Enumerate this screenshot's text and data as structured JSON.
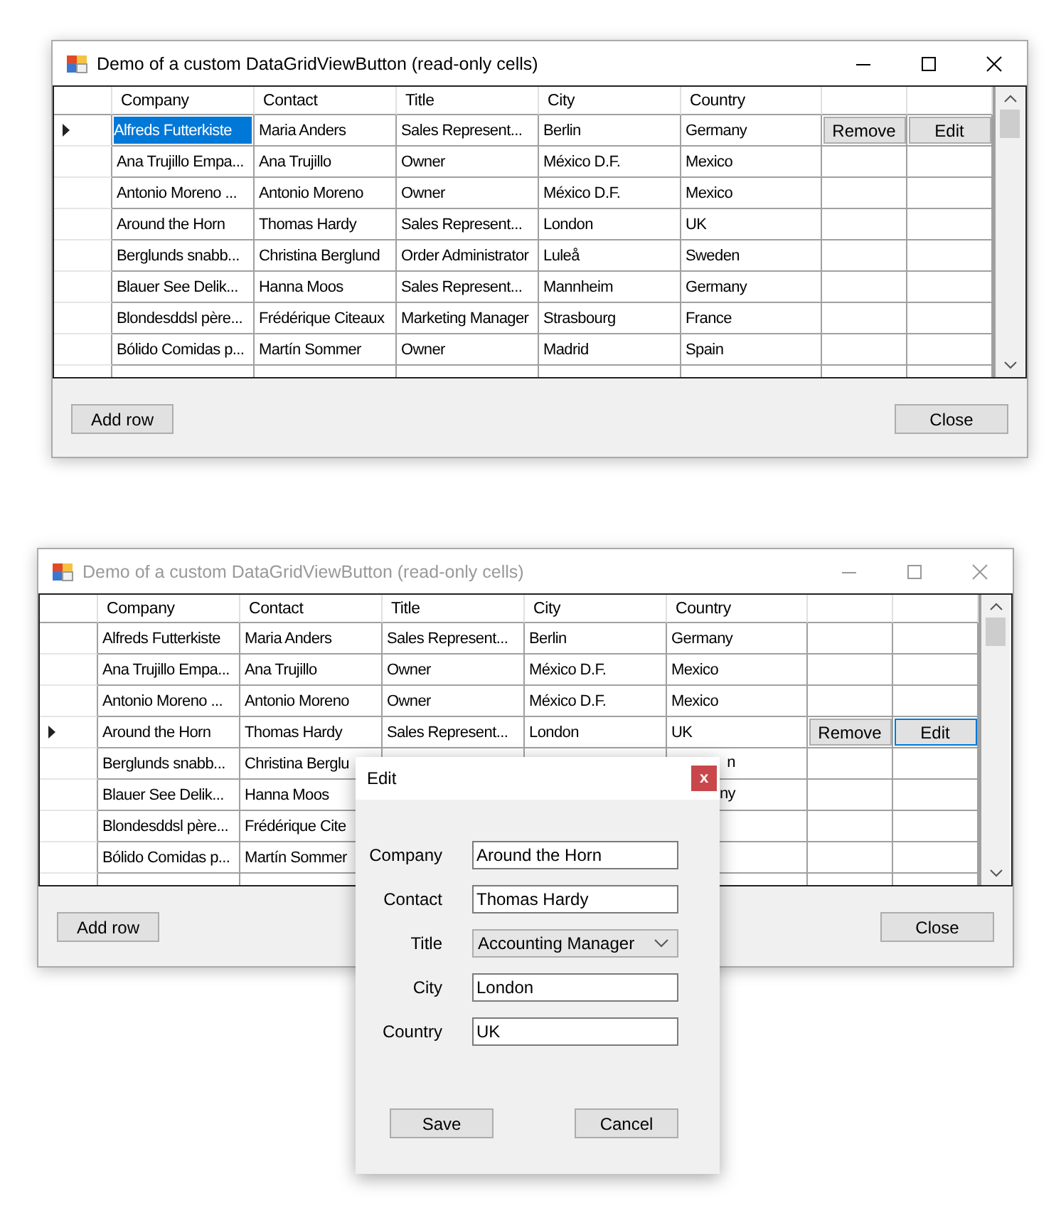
{
  "windows": [
    {
      "title": "Demo of a custom DataGridViewButton (read-only cells)",
      "active": true,
      "grid": {
        "columns": [
          "Company",
          "Contact",
          "Title",
          "City",
          "Country"
        ],
        "row_buttons": [
          {
            "label": "Remove",
            "focused": false
          },
          {
            "label": "Edit",
            "focused": false
          }
        ],
        "rows": [
          {
            "current": true,
            "company": "Alfreds Futterkiste",
            "contact": "Maria Anders",
            "title": "Sales Represent...",
            "city": "Berlin",
            "country": "Germany"
          },
          {
            "current": false,
            "company": "Ana Trujillo Empa...",
            "contact": "Ana Trujillo",
            "title": "Owner",
            "city": "México D.F.",
            "country": "Mexico"
          },
          {
            "current": false,
            "company": "Antonio Moreno ...",
            "contact": "Antonio Moreno",
            "title": "Owner",
            "city": "México D.F.",
            "country": "Mexico"
          },
          {
            "current": false,
            "company": "Around the Horn",
            "contact": "Thomas Hardy",
            "title": "Sales Represent...",
            "city": "London",
            "country": "UK"
          },
          {
            "current": false,
            "company": "Berglunds snabb...",
            "contact": "Christina Berglund",
            "title": "Order Administrator",
            "city": "Luleå",
            "country": "Sweden"
          },
          {
            "current": false,
            "company": "Blauer See Delik...",
            "contact": "Hanna Moos",
            "title": "Sales Represent...",
            "city": "Mannheim",
            "country": "Germany"
          },
          {
            "current": false,
            "company": "Blondesddsl père...",
            "contact": "Frédérique Citeaux",
            "title": "Marketing Manager",
            "city": "Strasbourg",
            "country": "France"
          },
          {
            "current": false,
            "company": "Bólido Comidas p...",
            "contact": "Martín Sommer",
            "title": "Owner",
            "city": "Madrid",
            "country": "Spain"
          }
        ]
      },
      "buttons": [
        "Add row",
        "Close"
      ]
    },
    {
      "title": "Demo of a custom DataGridViewButton (read-only cells)",
      "active": false,
      "grid": {
        "columns": [
          "Company",
          "Contact",
          "Title",
          "City",
          "Country"
        ],
        "row_buttons": [
          {
            "label": "Remove",
            "focused": false
          },
          {
            "label": "Edit",
            "focused": true
          }
        ],
        "rows": [
          {
            "current": false,
            "company": "Alfreds Futterkiste",
            "contact": "Maria Anders",
            "title": "Sales Represent...",
            "city": "Berlin",
            "country": "Germany"
          },
          {
            "current": false,
            "company": "Ana Trujillo Empa...",
            "contact": "Ana Trujillo",
            "title": "Owner",
            "city": "México D.F.",
            "country": "Mexico"
          },
          {
            "current": false,
            "company": "Antonio Moreno ...",
            "contact": "Antonio Moreno",
            "title": "Owner",
            "city": "México D.F.",
            "country": "Mexico"
          },
          {
            "current": true,
            "company": "Around the Horn",
            "contact": "Thomas Hardy",
            "title": "Sales Represent...",
            "city": "London",
            "country": "UK"
          },
          {
            "current": false,
            "company": "Berglunds snabb...",
            "contact": "Christina Berglu",
            "country": "n",
            "country_covered": true
          },
          {
            "current": false,
            "company": "Blauer See Delik...",
            "contact": "Hanna Moos",
            "country": "ny",
            "country_covered": true
          },
          {
            "current": false,
            "company": "Blondesddsl père...",
            "contact": "Frédérique Cite"
          },
          {
            "current": false,
            "company": "Bólido Comidas p...",
            "contact": "Martín Sommer"
          }
        ]
      },
      "buttons": [
        "Add row",
        "Close"
      ]
    }
  ],
  "dialog": {
    "title": "Edit",
    "close": "x",
    "fields": [
      {
        "label": "Company",
        "kind": "text",
        "value": "Around the Horn"
      },
      {
        "label": "Contact",
        "kind": "text",
        "value": "Thomas Hardy"
      },
      {
        "label": "Title",
        "kind": "combo",
        "value": "Accounting Manager"
      },
      {
        "label": "City",
        "kind": "text",
        "value": "London"
      },
      {
        "label": "Country",
        "kind": "text",
        "value": "UK"
      }
    ],
    "buttons": [
      "Save",
      "Cancel"
    ]
  }
}
